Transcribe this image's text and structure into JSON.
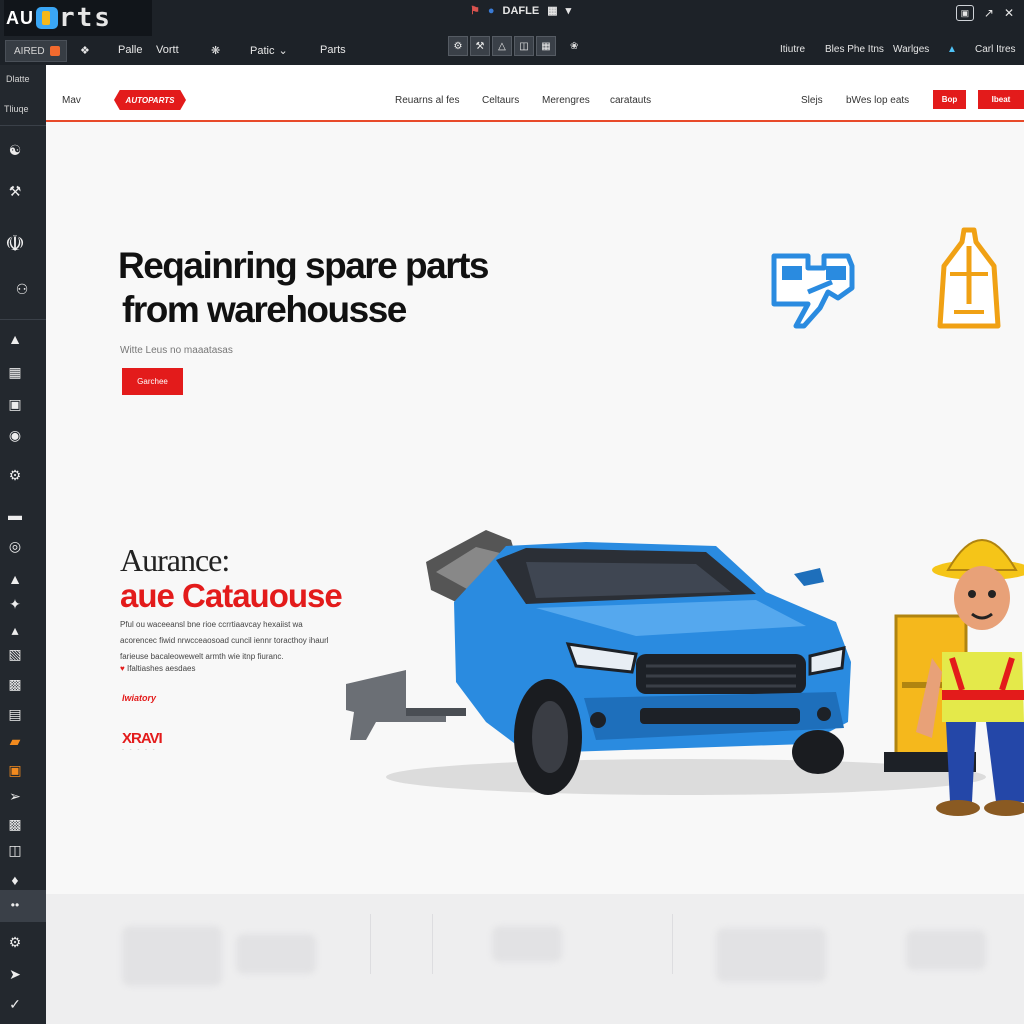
{
  "chrome": {
    "logo_au": "AU",
    "logo_parts": "rts",
    "title": "DAFLE",
    "toolbar": {
      "active_tab": "AIRED",
      "items": [
        "Palle",
        "Vortt",
        "Patic",
        "Parts"
      ],
      "right_links": [
        "Itiutre",
        "Bles Phe Itns",
        "Warlges",
        "Carl Itres"
      ]
    }
  },
  "sidebar": {
    "top_labels": [
      "Dlatte",
      "Tliuqe"
    ],
    "icons": [
      "bucket-icon",
      "tools-icon",
      "wrench-icon",
      "switch-icon",
      "car-icon",
      "car-icon",
      "car-icon",
      "tire-icon",
      "engine-icon",
      "bumper-icon",
      "tire-icon",
      "seat-icon",
      "tools-icon",
      "piston-icon",
      "door-icon",
      "wheel-icon",
      "chassis-icon",
      "lift-icon",
      "tools-icon",
      "car-icon",
      "car-icon",
      "pin-icon",
      "more-icon",
      "gear-icon",
      "arrow-icon",
      "check-icon"
    ]
  },
  "site_header": {
    "menu": "Mav",
    "logo": "AUTOPARTS",
    "nav": [
      "Reuarns al fes",
      "Celtaurs",
      "Merengres",
      "caratauts"
    ],
    "right_nav": [
      "Slejs",
      "bWes lop eats"
    ],
    "btn1": "Bop",
    "btn2": "Ibeat"
  },
  "hero": {
    "title_line1": "Reqainring  spare parts",
    "title_line2": "from warehousse",
    "subtitle": "Witte Leus no maaatasas",
    "button": "Garchee"
  },
  "section": {
    "title_a": "Aurance:",
    "title_b": "aue Catauouse",
    "body": "Pful ou waceeansl bne rioe ccrrtiaavcay hexaiist wa acorencec fiwid nrwcceaosoad cuncil iennr toracthoy ihaurl farieuse bacaleowewelt armth wie itnp fiuranc.",
    "bullet": "Ifaltiashes aesdaes",
    "tag": "Iwiatory",
    "brand": "XRAVI"
  },
  "colors": {
    "accent_red": "#e31b1b",
    "chrome_dark": "#1d2228",
    "car_blue": "#2a8be0",
    "hardhat_yellow": "#f5c518"
  }
}
